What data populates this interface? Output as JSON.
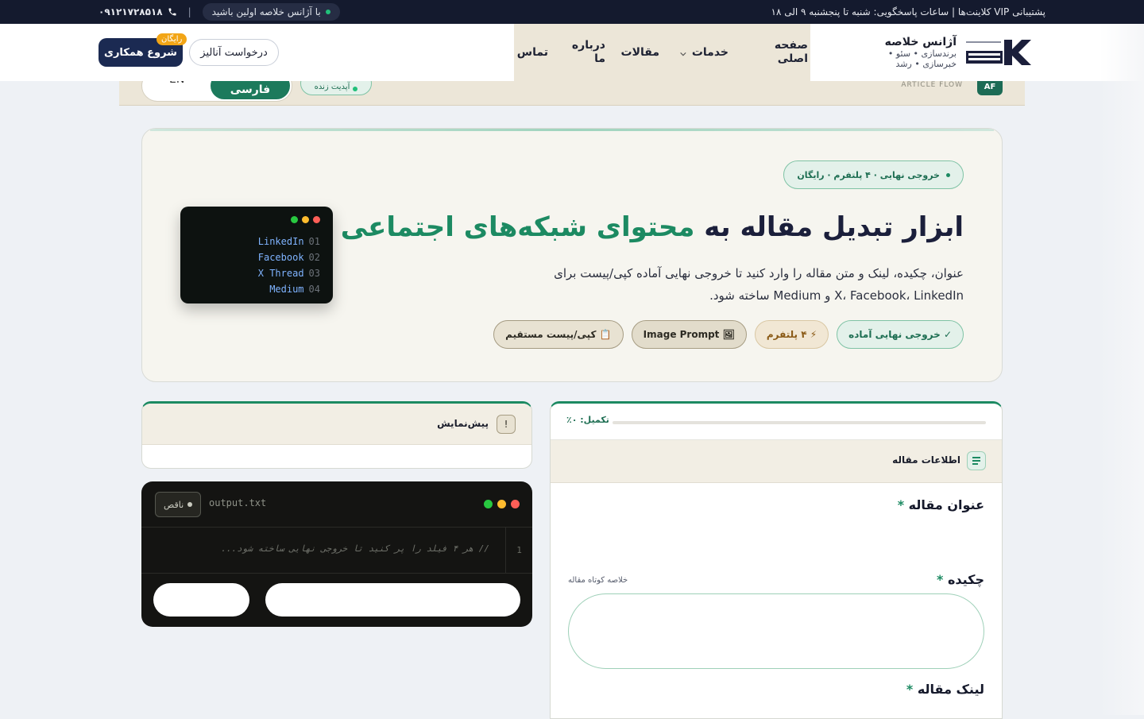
{
  "topbar": {
    "support_text": "پشتیبانی VIP کلاینت‌ها | ساعات پاسخگویی: شنبه تا پنجشنبه ۹ الی ۱۸",
    "agency_pill": "با آژانس خلاصه اولین باشید",
    "separator": "|",
    "phone": "۰۹۱۲۱۷۲۸۵۱۸"
  },
  "header": {
    "brand_name": "آژانس خلاصه",
    "brand_tagline": "برندسازی • سئو • خبرسازی • رشد",
    "nav": [
      "صفحه اصلی",
      "خدمات",
      "مقالات",
      "درباره ما",
      "تماس"
    ],
    "start_button": "شروع همکاری",
    "free_badge": "رایگان",
    "analyze_button": "درخواست آنالیز"
  },
  "strip": {
    "app_label": "ARTICLE FLOW",
    "lang_fa": "فارسی",
    "lang_en": "EN",
    "update_chip": "آپدیت زنده"
  },
  "hero": {
    "top_chip": "خروجی نهایی · ۴ پلتفرم · رایگان",
    "title_plain": "ابزار تبدیل مقاله به ",
    "title_accent": "محتوای شبکه‌های اجتماعی",
    "description": "عنوان، چکیده، لینک و متن مقاله را وارد کنید تا خروجی نهایی آماده کپی/پیست برای X، Facebook، LinkedIn و Medium ساخته شود.",
    "chips": [
      "✓ خروجی نهایی آماده",
      "⚡ ۴ پلتفرم",
      "🖼 Image Prompt",
      "📋 کپی/پیست مستقیم"
    ],
    "terminal_items": [
      {
        "no": "01",
        "name": "LinkedIn"
      },
      {
        "no": "02",
        "name": "Facebook"
      },
      {
        "no": "03",
        "name": "X Thread"
      },
      {
        "no": "04",
        "name": "Medium"
      }
    ]
  },
  "form": {
    "progress_label": "تکمیل: ۰٪",
    "progress_value": 0,
    "section_title": "اطلاعات مقاله",
    "title_label": "عنوان مقاله",
    "abstract_label": "چکیده",
    "abstract_hint": "خلاصه کوتاه مقاله",
    "link_label": "لینک مقاله",
    "required_mark": "*"
  },
  "preview": {
    "title": "پیش‌نمایش",
    "icon": "!"
  },
  "output": {
    "filename": "output.txt",
    "status": "ناقص",
    "line_no": "1",
    "placeholder": "// هر ۴ فیلد را پر کنید تا خروجی نهایی ساخته شود..."
  },
  "colors": {
    "accent": "#1c8a62",
    "navy": "#1b2a52",
    "beige": "#ece6d8",
    "topbar": "#141a2e"
  }
}
